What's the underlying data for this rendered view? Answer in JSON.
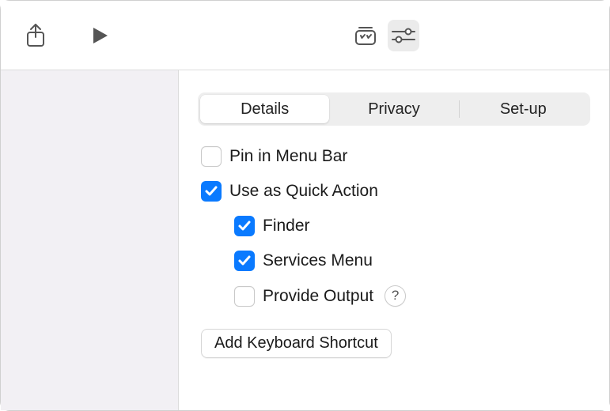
{
  "toolbar": {
    "share_icon": "share-icon",
    "play_icon": "play-icon",
    "library_icon": "library-icon",
    "settings_icon": "sliders-icon",
    "settings_active": true
  },
  "tabs": {
    "items": [
      {
        "label": "Details",
        "active": true
      },
      {
        "label": "Privacy",
        "active": false
      },
      {
        "label": "Set-up",
        "active": false
      }
    ]
  },
  "options": {
    "pin_label": "Pin in Menu Bar",
    "pin_checked": false,
    "quick_label": "Use as Quick Action",
    "quick_checked": true,
    "finder_label": "Finder",
    "finder_checked": true,
    "services_label": "Services Menu",
    "services_checked": true,
    "output_label": "Provide Output",
    "output_checked": false,
    "help_label": "?"
  },
  "shortcut_button": "Add Keyboard Shortcut"
}
